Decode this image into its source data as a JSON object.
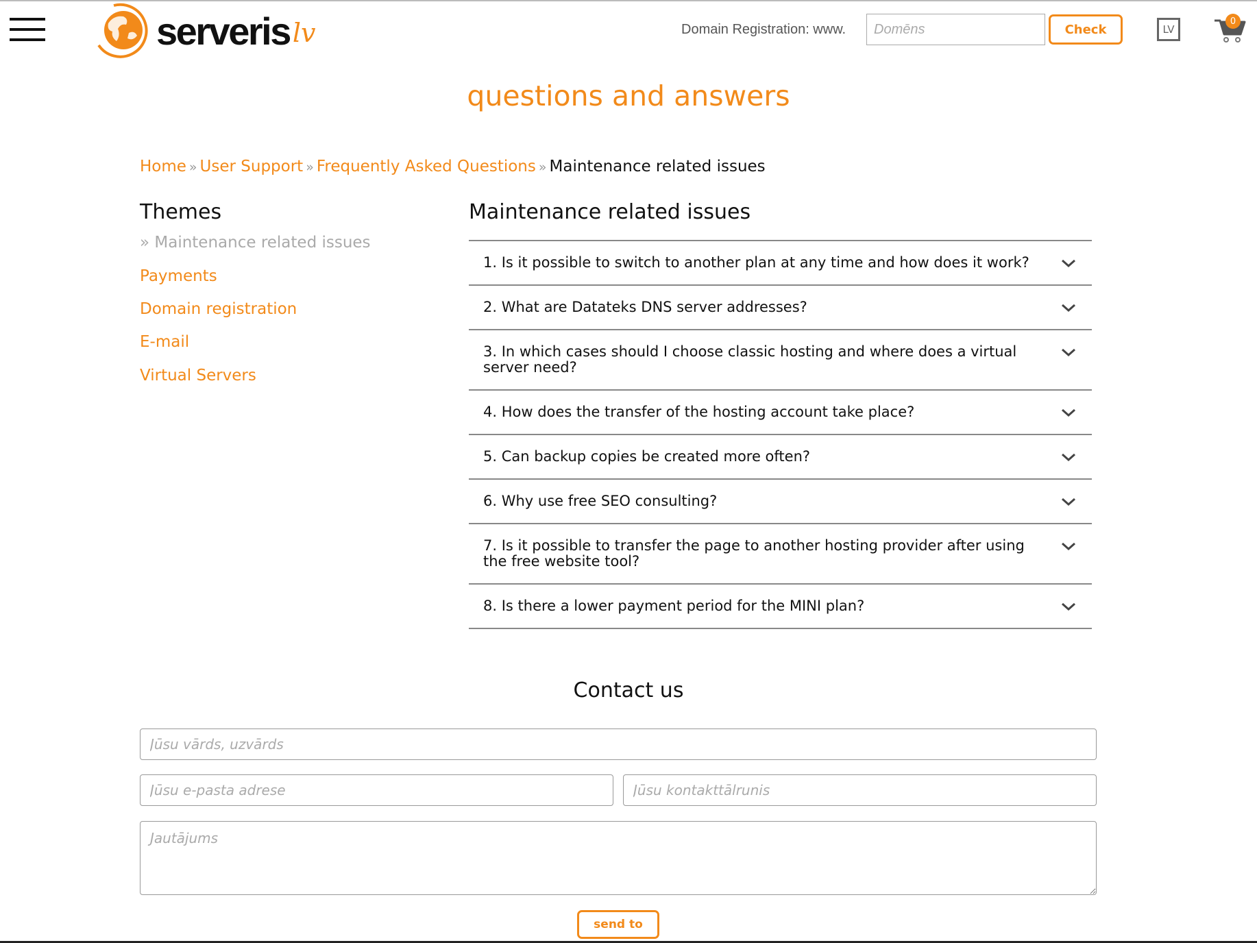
{
  "header": {
    "logo_text": "serveris",
    "logo_tld": "lv",
    "domain_label": "Domain Registration: www.",
    "domain_placeholder": "Domēns",
    "check_label": "Check",
    "language": "LV",
    "cart_count": "0",
    "accent_color": "#f28a1a"
  },
  "page_title": "questions and answers",
  "breadcrumb": {
    "items": [
      "Home",
      "User Support",
      "Frequently Asked Questions"
    ],
    "separator": "»",
    "current": "Maintenance related issues"
  },
  "themes": {
    "title": "Themes",
    "current": "» Maintenance related issues",
    "links": [
      "Payments",
      "Domain registration",
      "E-mail",
      "Virtual Servers"
    ]
  },
  "faq": {
    "title": "Maintenance related issues",
    "items": [
      "1. Is it possible to switch to another plan at any time and how does it work?",
      "2. What are Datateks DNS server addresses?",
      "3. In which cases should I choose classic hosting and where does a virtual server need?",
      "4. How does the transfer of the hosting account take place?",
      "5. Can backup copies be created more often?",
      "6. Why use free SEO consulting?",
      "7. Is it possible to transfer the page to another hosting provider after using the free website tool?",
      "8. Is there a lower payment period for the MINI plan?"
    ]
  },
  "contact": {
    "title": "Contact us",
    "name_placeholder": "Jūsu vārds, uzvārds",
    "email_placeholder": "Jūsu e-pasta adrese",
    "phone_placeholder": "Jūsu kontakttālrunis",
    "question_placeholder": "Jautājums",
    "send_label": "send to"
  }
}
